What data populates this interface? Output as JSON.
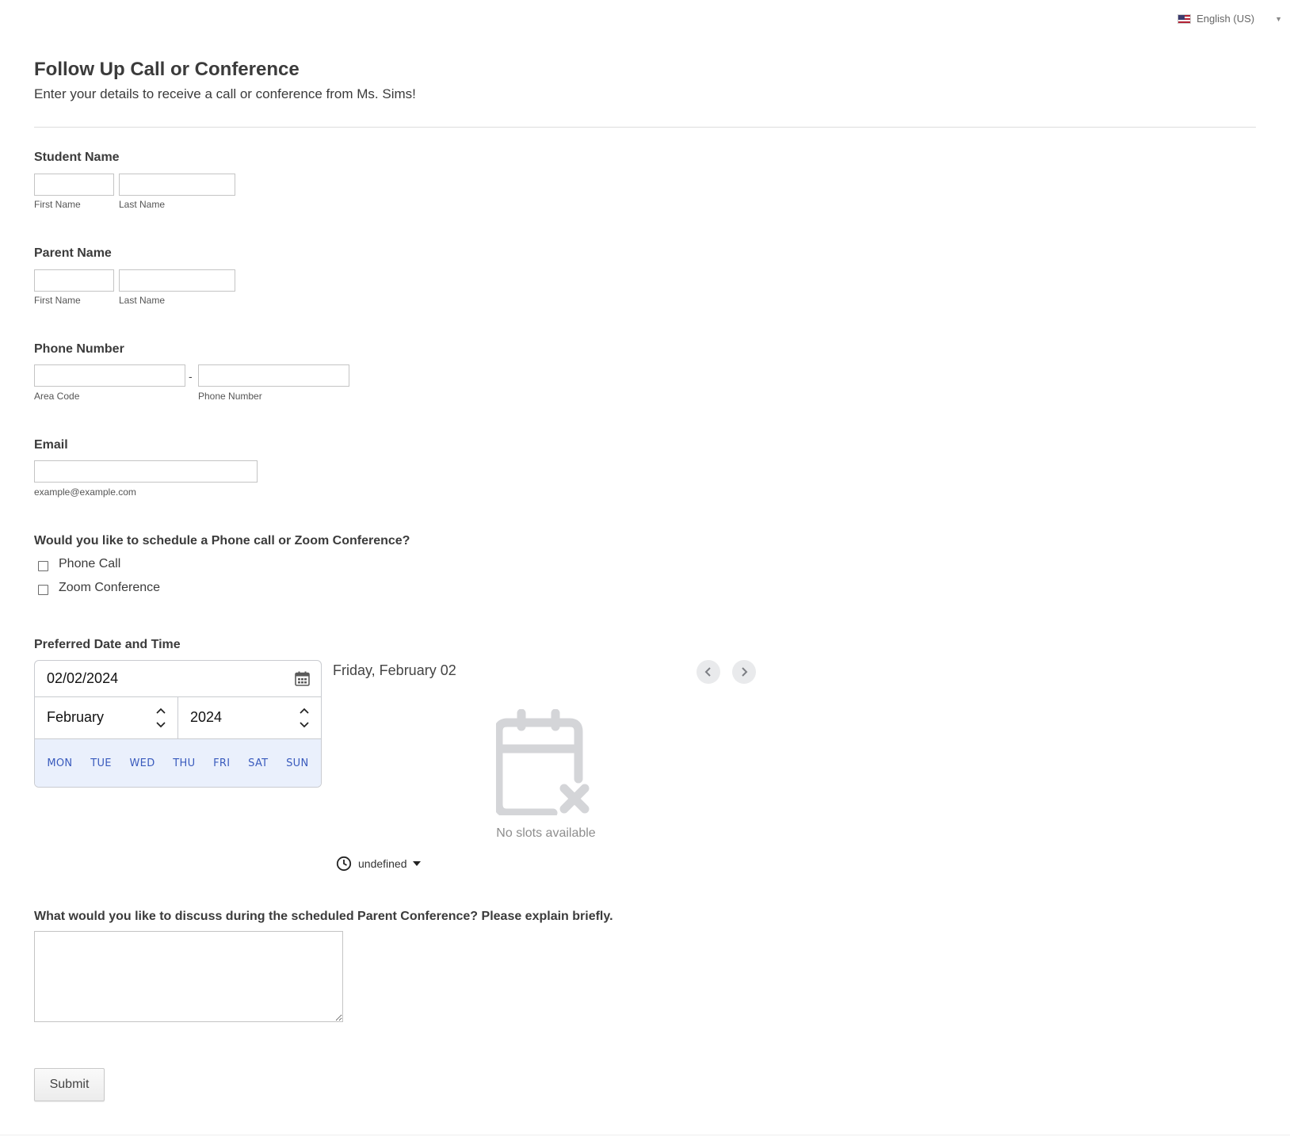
{
  "language": {
    "label": "English (US)",
    "flag_icon": "us-flag-icon"
  },
  "form": {
    "title": "Follow Up Call or Conference",
    "subtitle": "Enter your details to receive a call or conference from Ms. Sims!",
    "student_name": {
      "label": "Student Name",
      "first_sub": "First Name",
      "last_sub": "Last Name",
      "first_value": "",
      "last_value": ""
    },
    "parent_name": {
      "label": "Parent Name",
      "first_sub": "First Name",
      "last_sub": "Last Name",
      "first_value": "",
      "last_value": ""
    },
    "phone": {
      "label": "Phone Number",
      "separator": "-",
      "area_sub": "Area Code",
      "number_sub": "Phone Number",
      "area_value": "",
      "number_value": ""
    },
    "email": {
      "label": "Email",
      "sub": "example@example.com",
      "value": ""
    },
    "meeting_type": {
      "label": "Would you like to schedule a Phone call or Zoom Conference?",
      "options": [
        {
          "label": "Phone Call",
          "checked": false
        },
        {
          "label": "Zoom Conference",
          "checked": false
        }
      ]
    },
    "datetime": {
      "label": "Preferred Date and Time",
      "date_value": "02/02/2024",
      "month": "February",
      "year": "2024",
      "weekdays": [
        "MON",
        "TUE",
        "WED",
        "THU",
        "FRI",
        "SAT",
        "SUN"
      ],
      "selected_date_text": "Friday, February 02",
      "no_slots_text": "No slots available",
      "timezone": "undefined"
    },
    "discuss": {
      "label": "What would you like to discuss during the scheduled Parent Conference? Please explain briefly.",
      "value": ""
    },
    "submit_label": "Submit"
  },
  "colors": {
    "weekday_text": "#3a5bbd",
    "weekday_bg": "#eaf0fc",
    "empty_icon": "#d4d5d8"
  }
}
